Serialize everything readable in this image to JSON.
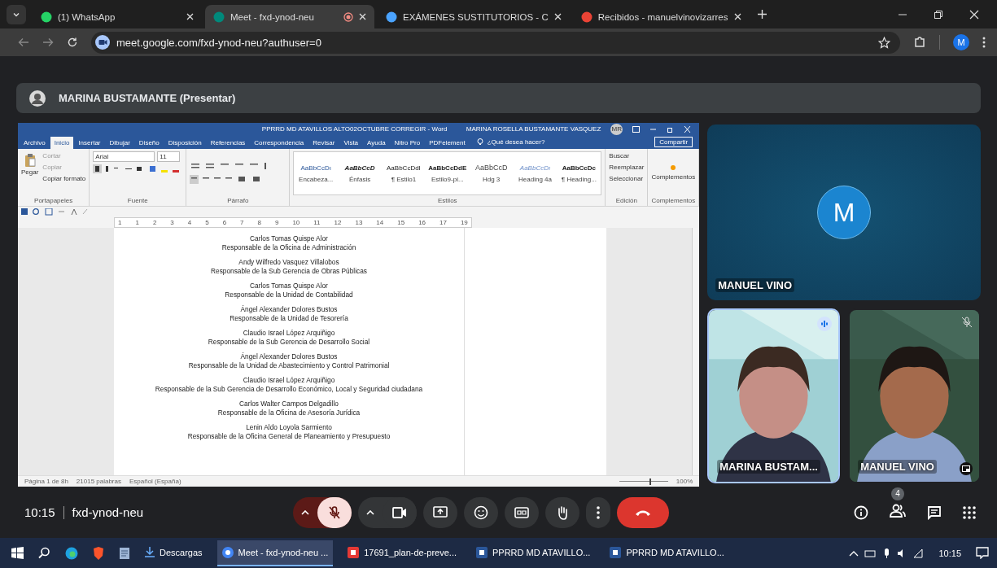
{
  "browser": {
    "tabs": [
      {
        "title": "(1) WhatsApp",
        "kind": "whatsapp",
        "selected": false,
        "recording": false
      },
      {
        "title": "Meet - fxd-ynod-neu",
        "kind": "meet",
        "selected": true,
        "recording": true
      },
      {
        "title": "EXÁMENES SUSTITUTORIOS - C",
        "kind": "cloud",
        "selected": false,
        "recording": false
      },
      {
        "title": "Recibidos - manuelvinovizarres",
        "kind": "mail",
        "selected": false,
        "recording": false
      }
    ],
    "url": "meet.google.com/fxd-ynod-neu?authuser=0",
    "profile_initial": "M"
  },
  "presenter": {
    "label": "MARINA BUSTAMANTE (Presentar)"
  },
  "word": {
    "title": "PPRRD MD ATAVILLOS ALTO02OCTUBRE CORREGIR - Word",
    "user": "MARINA ROSELLA BUSTAMANTE VASQUEZ",
    "user_initials": "MR",
    "share": "Compartir",
    "menu_tabs": [
      {
        "label": "Archivo",
        "selected": false
      },
      {
        "label": "Inicio",
        "selected": true
      },
      {
        "label": "Insertar",
        "selected": false
      },
      {
        "label": "Dibujar",
        "selected": false
      },
      {
        "label": "Diseño",
        "selected": false
      },
      {
        "label": "Disposición",
        "selected": false
      },
      {
        "label": "Referencias",
        "selected": false
      },
      {
        "label": "Correspondencia",
        "selected": false
      },
      {
        "label": "Revisar",
        "selected": false
      },
      {
        "label": "Vista",
        "selected": false
      },
      {
        "label": "Ayuda",
        "selected": false
      },
      {
        "label": "Nitro Pro",
        "selected": false
      },
      {
        "label": "PDFelement",
        "selected": false
      }
    ],
    "search_hint": "¿Qué desea hacer?",
    "clipboard": {
      "paste": "Pegar",
      "items": [
        "Cortar",
        "Copiar",
        "Copiar formato"
      ],
      "label": "Portapapeles"
    },
    "font": {
      "name": "Arial",
      "size": "11",
      "label": "Fuente"
    },
    "paragraph": {
      "label": "Párrafo"
    },
    "styles": {
      "label": "Estilos",
      "items": [
        {
          "preview": "AaBbCcDı",
          "name": "Encabeza..."
        },
        {
          "preview": "AaBbCcD",
          "name": "Énfasis"
        },
        {
          "preview": "AaBbCcDdI",
          "name": "¶ Estilo1"
        },
        {
          "preview": "AaBbCcDdE",
          "name": "Estilo9-pi..."
        },
        {
          "preview": "AaBbCcD",
          "name": "Hdg 3"
        },
        {
          "preview": "AaBbCcDı",
          "name": "Heading 4a"
        },
        {
          "preview": "AaBbCcDc",
          "name": "¶ Heading..."
        }
      ]
    },
    "editing": {
      "label": "Edición",
      "items": [
        "Buscar",
        "Reemplazar",
        "Seleccionar"
      ]
    },
    "addins": {
      "button": "Complementos",
      "label": "Complementos"
    },
    "ruler": [
      "1",
      "1",
      "2",
      "3",
      "4",
      "5",
      "6",
      "7",
      "8",
      "9",
      "10",
      "11",
      "12",
      "13",
      "14",
      "15",
      "16",
      "17",
      "19"
    ],
    "document": [
      {
        "name": "Carlos Tomas Quispe Alor",
        "role": "Responsable de la Oficina de Administración"
      },
      {
        "name": "Andy Wilfredo Vasquez Villalobos",
        "role": "Responsable de la Sub Gerencia de Obras Públicas"
      },
      {
        "name": "Carlos Tomas Quispe Alor",
        "role": "Responsable de la Unidad de Contabilidad"
      },
      {
        "name": "Ángel Alexander Dolores Bustos",
        "role": "Responsable de la Unidad de Tesorería"
      },
      {
        "name": "Claudio Israel López Arquiñigo",
        "role": "Responsable de la Sub Gerencia de Desarrollo Social"
      },
      {
        "name": "Ángel Alexander Dolores Bustos",
        "role": "Responsable de la Unidad de Abastecimiento y Control Patrimonial"
      },
      {
        "name": "Claudio Israel López Arquiñigo",
        "role": "Responsable de la Sub Gerencia de Desarrollo Económico, Local y Seguridad ciudadana"
      },
      {
        "name": "Carlos Walter Campos Delgadillo",
        "role": "Responsable de la Oficina de Asesoría Jurídica"
      },
      {
        "name": "Lenin Aldo Loyola Sarmiento",
        "role": "Responsable de la Oficina General de Planeamiento y Presupuesto"
      }
    ],
    "status": [
      "Página 1 de 8h",
      "21015 palabras",
      "Español (España)"
    ],
    "zoom": "100%",
    "zoom_slider": {
      "level": 0.62
    }
  },
  "featured_tile": {
    "name": "MANUEL VINO",
    "initial": "M"
  },
  "tiles": [
    {
      "name": "MARINA BUSTAM...",
      "speaking": true,
      "muted": false
    },
    {
      "name": "MANUEL VINO",
      "speaking": false,
      "muted": true
    }
  ],
  "meeting": {
    "time": "10:15",
    "code": "fxd-ynod-neu",
    "mic_muted": true,
    "people_count": "4"
  },
  "taskbar": {
    "items": [
      {
        "label": "Descargas",
        "kind": "folder",
        "selected": false
      },
      {
        "label": "Meet - fxd-ynod-neu ...",
        "kind": "chrome",
        "selected": true
      },
      {
        "label": "17691_plan-de-preve...",
        "kind": "pdf",
        "selected": false
      },
      {
        "label": "PPRRD MD ATAVILLO...",
        "kind": "word",
        "selected": false
      },
      {
        "label": "PPRRD MD ATAVILLO...",
        "kind": "word",
        "selected": false
      }
    ],
    "clock": "10:15"
  }
}
